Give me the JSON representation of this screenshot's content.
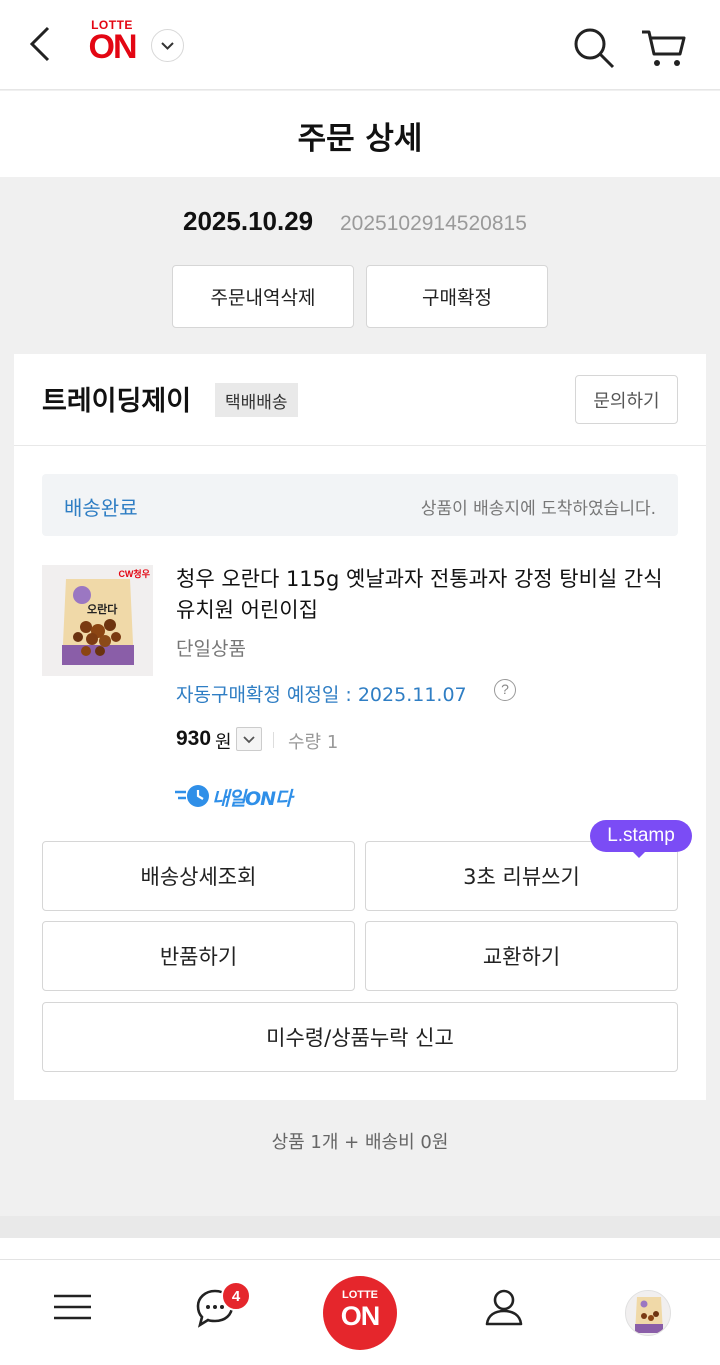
{
  "header": {
    "logo_top": "LOTTE",
    "logo_main": "ON",
    "back_icon": "chevron-left-icon",
    "search_icon": "search-icon",
    "cart_icon": "cart-icon"
  },
  "title": "주문 상세",
  "order": {
    "date": "2025.10.29",
    "number": "2025102914520815",
    "delete_label": "주문내역삭제",
    "confirm_label": "구매확정"
  },
  "seller": {
    "name": "트레이딩제이",
    "shipping_type": "택배배송",
    "inquiry_label": "문의하기"
  },
  "status": {
    "label": "배송완료",
    "message": "상품이 배송지에 도착하였습니다."
  },
  "product": {
    "name": "청우 오란다 115g 옛날과자 전통과자 강정 탕비실 간식 유치원 어린이집",
    "option": "단일상품",
    "auto_confirm": "자동구매확정 예정일 : 2025.11.07",
    "price": "930",
    "price_unit": "원",
    "qty": "수량 1",
    "delivery_badge": "내일ON다",
    "thumb_brand": "CW청우",
    "thumb_label": "오란다"
  },
  "actions": {
    "track": "배송상세조회",
    "review": "3초 리뷰쓰기",
    "return": "반품하기",
    "exchange": "교환하기",
    "report": "미수령/상품누락 신고",
    "stamp": "L.stamp"
  },
  "totals": "상품 1개 + 배송비 0원",
  "bottom_nav": {
    "chat_badge": "4",
    "home_top": "LOTTE",
    "home_main": "ON"
  },
  "colors": {
    "brand_red": "#e30613",
    "accent_blue": "#2f7ec4",
    "stamp_purple": "#7b4cf5"
  }
}
